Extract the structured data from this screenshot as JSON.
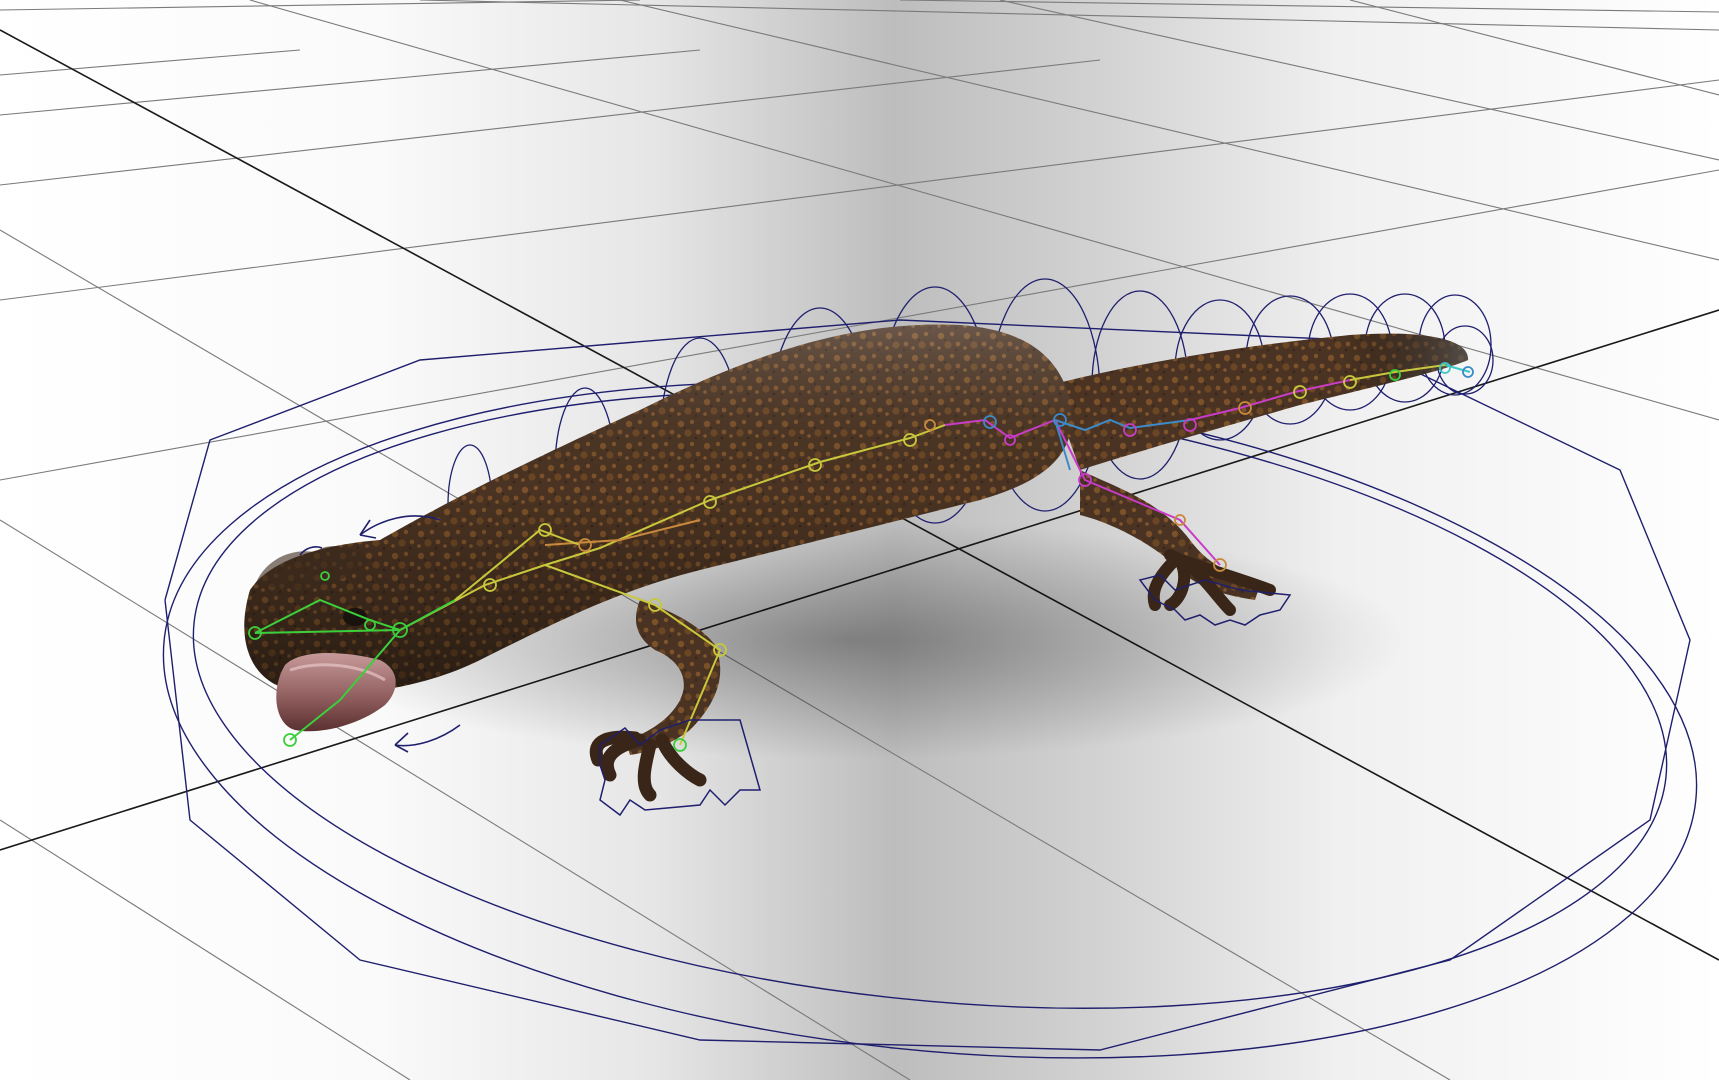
{
  "viewport": {
    "app": "3D viewport",
    "subject": "salamander-rig",
    "grid_visible": true,
    "colors": {
      "grid_line": "#1a1a1a",
      "grid_line_light": "#7a7a7a",
      "control_curve": "#1f1f6e",
      "skin_base": "#4a3322",
      "skin_spot": "#8a5a2b",
      "mouth_inner": "#8c5a5a",
      "joint_green": "#3ccf3c",
      "joint_yellow": "#c8c83c",
      "joint_orange": "#c88a3c",
      "joint_magenta": "#c83cc8",
      "joint_blue": "#3c8ac8",
      "joint_cyan": "#3cc8c8"
    },
    "icons": [
      "move-arrows-icon",
      "rotate-arrow-icon"
    ]
  }
}
